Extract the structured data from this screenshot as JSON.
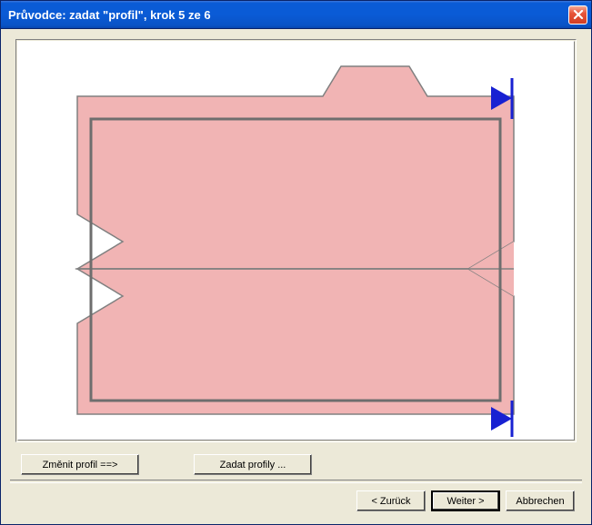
{
  "window": {
    "title": "Průvodce: zadat \"profil\", krok 5 ze 6"
  },
  "buttons": {
    "change_profile": "Změnit profil  ==>",
    "enter_profiles": "Zadat profily ...",
    "back": "< Zurück",
    "next": "Weiter >",
    "cancel": "Abbrechen"
  },
  "colors": {
    "shape_fill": "#F1B4B4",
    "shape_stroke": "#808080",
    "rect_stroke": "#808080",
    "marker": "#1821D2"
  }
}
